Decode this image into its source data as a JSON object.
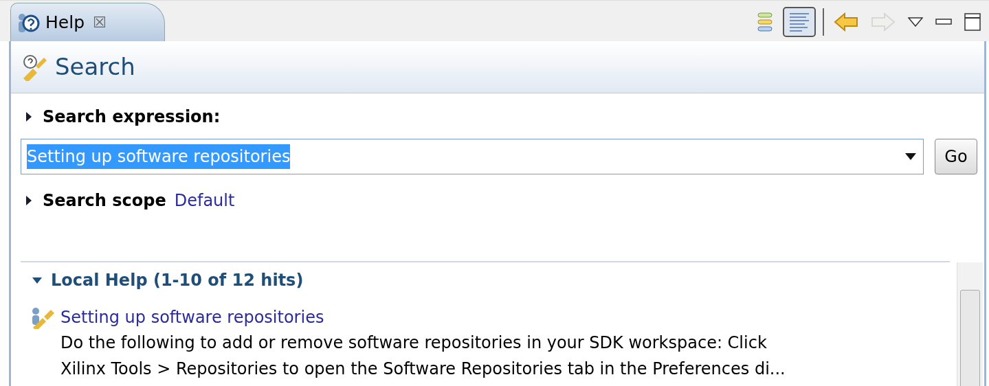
{
  "tab": {
    "title": "Help",
    "close": "☒"
  },
  "toolbar": [
    {
      "kind": "categories",
      "pressed": false,
      "disabled": false
    },
    {
      "kind": "descriptions",
      "pressed": true,
      "disabled": false
    },
    {
      "kind": "back",
      "pressed": false,
      "disabled": false
    },
    {
      "kind": "forward",
      "pressed": false,
      "disabled": true
    },
    {
      "kind": "view-menu",
      "pressed": false,
      "disabled": false
    },
    {
      "kind": "minimize",
      "pressed": false,
      "disabled": false
    },
    {
      "kind": "maximize",
      "pressed": false,
      "disabled": false
    }
  ],
  "header": {
    "title": "Search"
  },
  "search_expression": {
    "label": "Search expression:",
    "expanded": false,
    "value": "Setting up software repositories",
    "value_selected": true,
    "button": "Go"
  },
  "search_scope": {
    "label": "Search scope",
    "expanded": false,
    "value": "Default"
  },
  "results": {
    "heading": "Local Help (1-10 of 12 hits)",
    "expanded": true,
    "hits": [
      {
        "title": "Setting up software repositories",
        "description": "Do the following to add or remove software repositories in your SDK workspace: Click\nXilinx Tools > Repositories to open the Software Repositories tab in the Preferences di..."
      }
    ]
  }
}
